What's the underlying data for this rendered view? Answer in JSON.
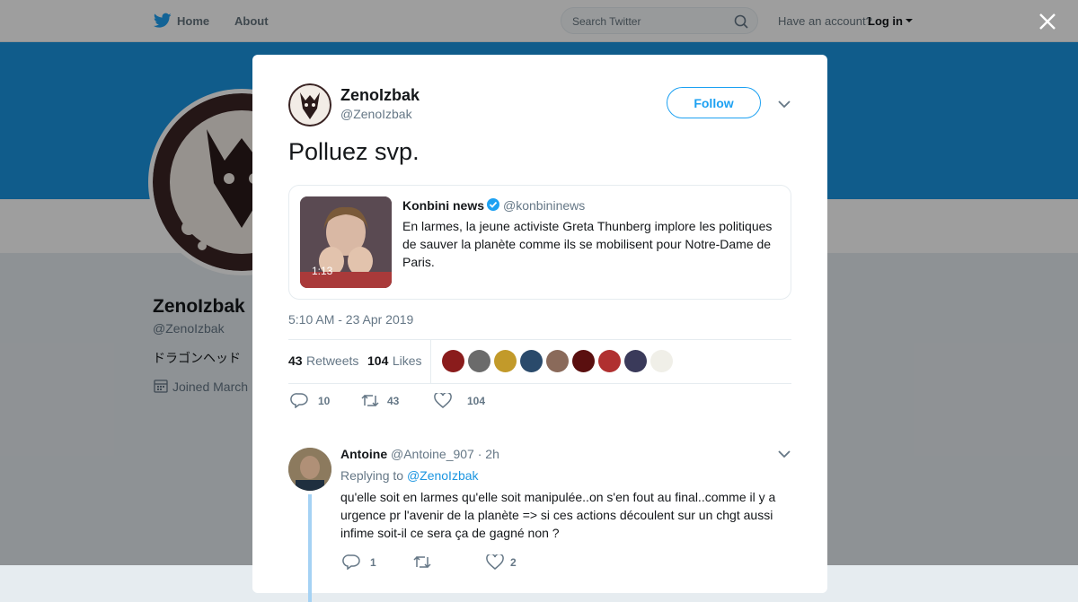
{
  "topnav": {
    "home": "Home",
    "about": "About",
    "search_placeholder": "Search Twitter",
    "account_prompt": "Have an account?",
    "login": "Log in"
  },
  "profile_bg": {
    "name": "ZenoIzbak",
    "handle": "@ZenoIzbak",
    "bio": "ドラゴンヘッド",
    "joined": "Joined March",
    "banner_color": "#1b95e0"
  },
  "tweet": {
    "author_name": "ZenoIzbak",
    "author_handle": "@ZenoIzbak",
    "follow_label": "Follow",
    "text": "Polluez svp.",
    "quoted": {
      "name": "Konbini news",
      "handle": "@konbininews",
      "verified": true,
      "text": "En larmes, la jeune activiste Greta Thunberg implore les politiques de sauver la planète comme ils se mobilisent pour Notre-Dame de Paris.",
      "video_duration": "1:13"
    },
    "timestamp": "5:10 AM - 23 Apr 2019",
    "retweets": "43",
    "retweets_label": "Retweets",
    "likes": "104",
    "likes_label": "Likes",
    "liker_colors": [
      "#8a1c1c",
      "#6b6b6b",
      "#c29a2a",
      "#2a4a6b",
      "#8a6a5a",
      "#5a0f0f",
      "#b03030",
      "#3a3a5a",
      "#f0efe8"
    ],
    "actions": {
      "replies": "10",
      "retweets": "43",
      "likes": "104"
    }
  },
  "reply": {
    "name": "Antoine",
    "handle": "@Antoine_907 · 2h",
    "replying_prefix": "Replying to",
    "replying_to": "@ZenoIzbak",
    "text": "qu'elle soit en larmes qu'elle soit manipulée..on s'en fout au final..comme il  y a urgence pr l'avenir de la planète => si ces actions découlent sur un chgt aussi infime soit-il ce sera ça de gagné non ?",
    "actions": {
      "replies": "1",
      "retweets": "",
      "likes": "2"
    }
  },
  "colors": {
    "accent": "#1da1f2",
    "secondary_text": "#657786"
  }
}
